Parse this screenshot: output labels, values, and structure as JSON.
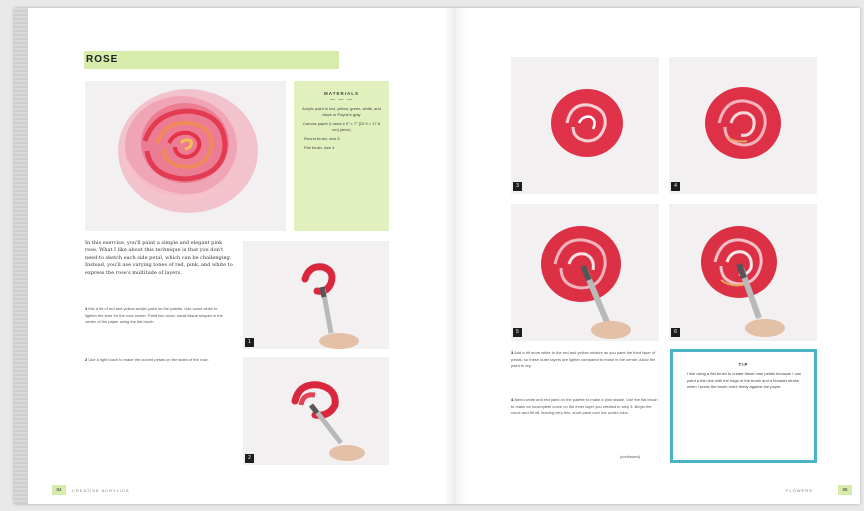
{
  "left_page": {
    "title": "ROSE",
    "materials": {
      "heading": "MATERIALS",
      "divider": "— — —",
      "items": [
        "Acrylic paint in red, yellow, green, white, and black or Payne's gray",
        "Canvas paper (I used a 9\" × 7\" [22.9 × 17.8 cm] piece)",
        "Round brush, size 6",
        "Flat brush, size 4"
      ]
    },
    "intro": "In this exercise, you'll paint a simple and elegant pink rose. What I like about this technique is that you don't need to sketch each side petal, which can be challenging. Instead, you'll use varying tones of red, pink, and white to express the rose's multitude of layers.",
    "step1": {
      "number": "1",
      "text": "Mix a bit of red and yellow acrylic paint on the palette. Use some white to lighten the tone for the rose center. Paint two close, small tissue shapes in the center of the paper using the flat brush."
    },
    "step2": {
      "number": "2",
      "text": "Use a light touch to make the curved petals on the sides of the rose."
    },
    "folio_text": "CREATIVE ACRYLICS",
    "page_number": "84"
  },
  "right_page": {
    "step_badges": [
      "3",
      "4",
      "5",
      "6"
    ],
    "step3": {
      "number": "3",
      "text": "Add a bit more white to the red and yellow mixture as you paint the third layer of petals, so these outer layers are lighter compared to those in the center. Allow the paint to dry."
    },
    "step4": {
      "number": "4",
      "text": "Blend white and red paint on the palette to make a pink shade. Use the flat brush to make an incomplete curve on the inner layer you created in step 3. Begin the curve and lift off, leaving very thin, short paint over the under color."
    },
    "continued": "(continued)",
    "tip": {
      "heading": "TIP",
      "text": "I like using a flat brush to create these rose petals because I can paint a thin line with the edge of the brush and a broader stroke when I press the brush more firmly against the paper."
    },
    "folio_text": "FLOWERS",
    "page_number": "85"
  }
}
